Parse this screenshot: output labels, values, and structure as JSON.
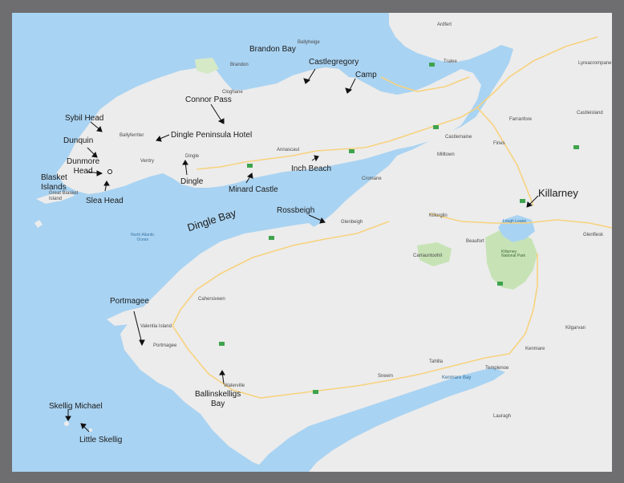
{
  "annotations": {
    "brandon_bay": "Brandon Bay",
    "castlegregory": "Castlegregory",
    "camp": "Camp",
    "connor_pass": "Connor Pass",
    "sybil_head": "Sybil Head",
    "dingle_peninsula_hotel": "Dingle Peninsula Hotel",
    "dunquin": "Dunquin",
    "dunmore_head": "Dunmore\nHead",
    "blasket_islands": "Blasket\nIslands",
    "slea_head": "Slea Head",
    "dingle": "Dingle",
    "minard_castle": "Minard Castle",
    "inch_beach": "Inch Beach",
    "dingle_bay": "Dingle Bay",
    "rossbeigh": "Rossbeigh",
    "killarney": "Killarney",
    "portmagee": "Portmagee",
    "ballinskelligs_bay": "Ballinskelligs\nBay",
    "skellig_michael": "Skellig Michael",
    "little_skellig": "Little Skellig"
  },
  "map_labels": {
    "north_atlantic": "North Atlantic\nOcean",
    "ballyheigue": "Ballyheige",
    "ardfert": "Ardfert",
    "tralee": "Tralee",
    "castleisland": "Castleisland",
    "farranfore": "Farranfore",
    "killorglin": "Killorglin",
    "glenbeigh": "Glenbeigh",
    "cahersiveen": "Cahersiveen",
    "valentia_island": "Valentia Island",
    "portmagee_town": "Portmagee",
    "waterville": "Waterville",
    "sneem": "Sneem",
    "kenmare": "Kenmare",
    "kenmare_bay": "Kenmare Bay",
    "killarney_park": "Killarney\nNational Park",
    "carrauntoohil": "Carrauntoohil",
    "beaufort": "Beaufort",
    "milltown": "Milltown",
    "castlemaine": "Castlemaine",
    "annascaul": "Annascaul",
    "dingle_town": "Dingle",
    "ballyferriter": "Ballyferriter",
    "brandon": "Brandon",
    "cloghane": "Cloghane",
    "knocknagoshel": "Lyreacrompane",
    "firies": "Firies",
    "glenflesk": "Glenflesk",
    "tahilla": "Tahilla",
    "templenoe": "Templenoe",
    "kilgarvan": "Kilgarvan",
    "derreen": "Lauragh",
    "great_blasket": "Great Blasket\nIsland",
    "cromane": "Cromane",
    "ventry": "Ventry",
    "lough_leane": "Lough Leane"
  },
  "colors": {
    "water": "#a9d3f2",
    "land": "#ececec",
    "park": "#c7e3b6",
    "road": "#f7d27e",
    "frame": "#6e6e70"
  }
}
